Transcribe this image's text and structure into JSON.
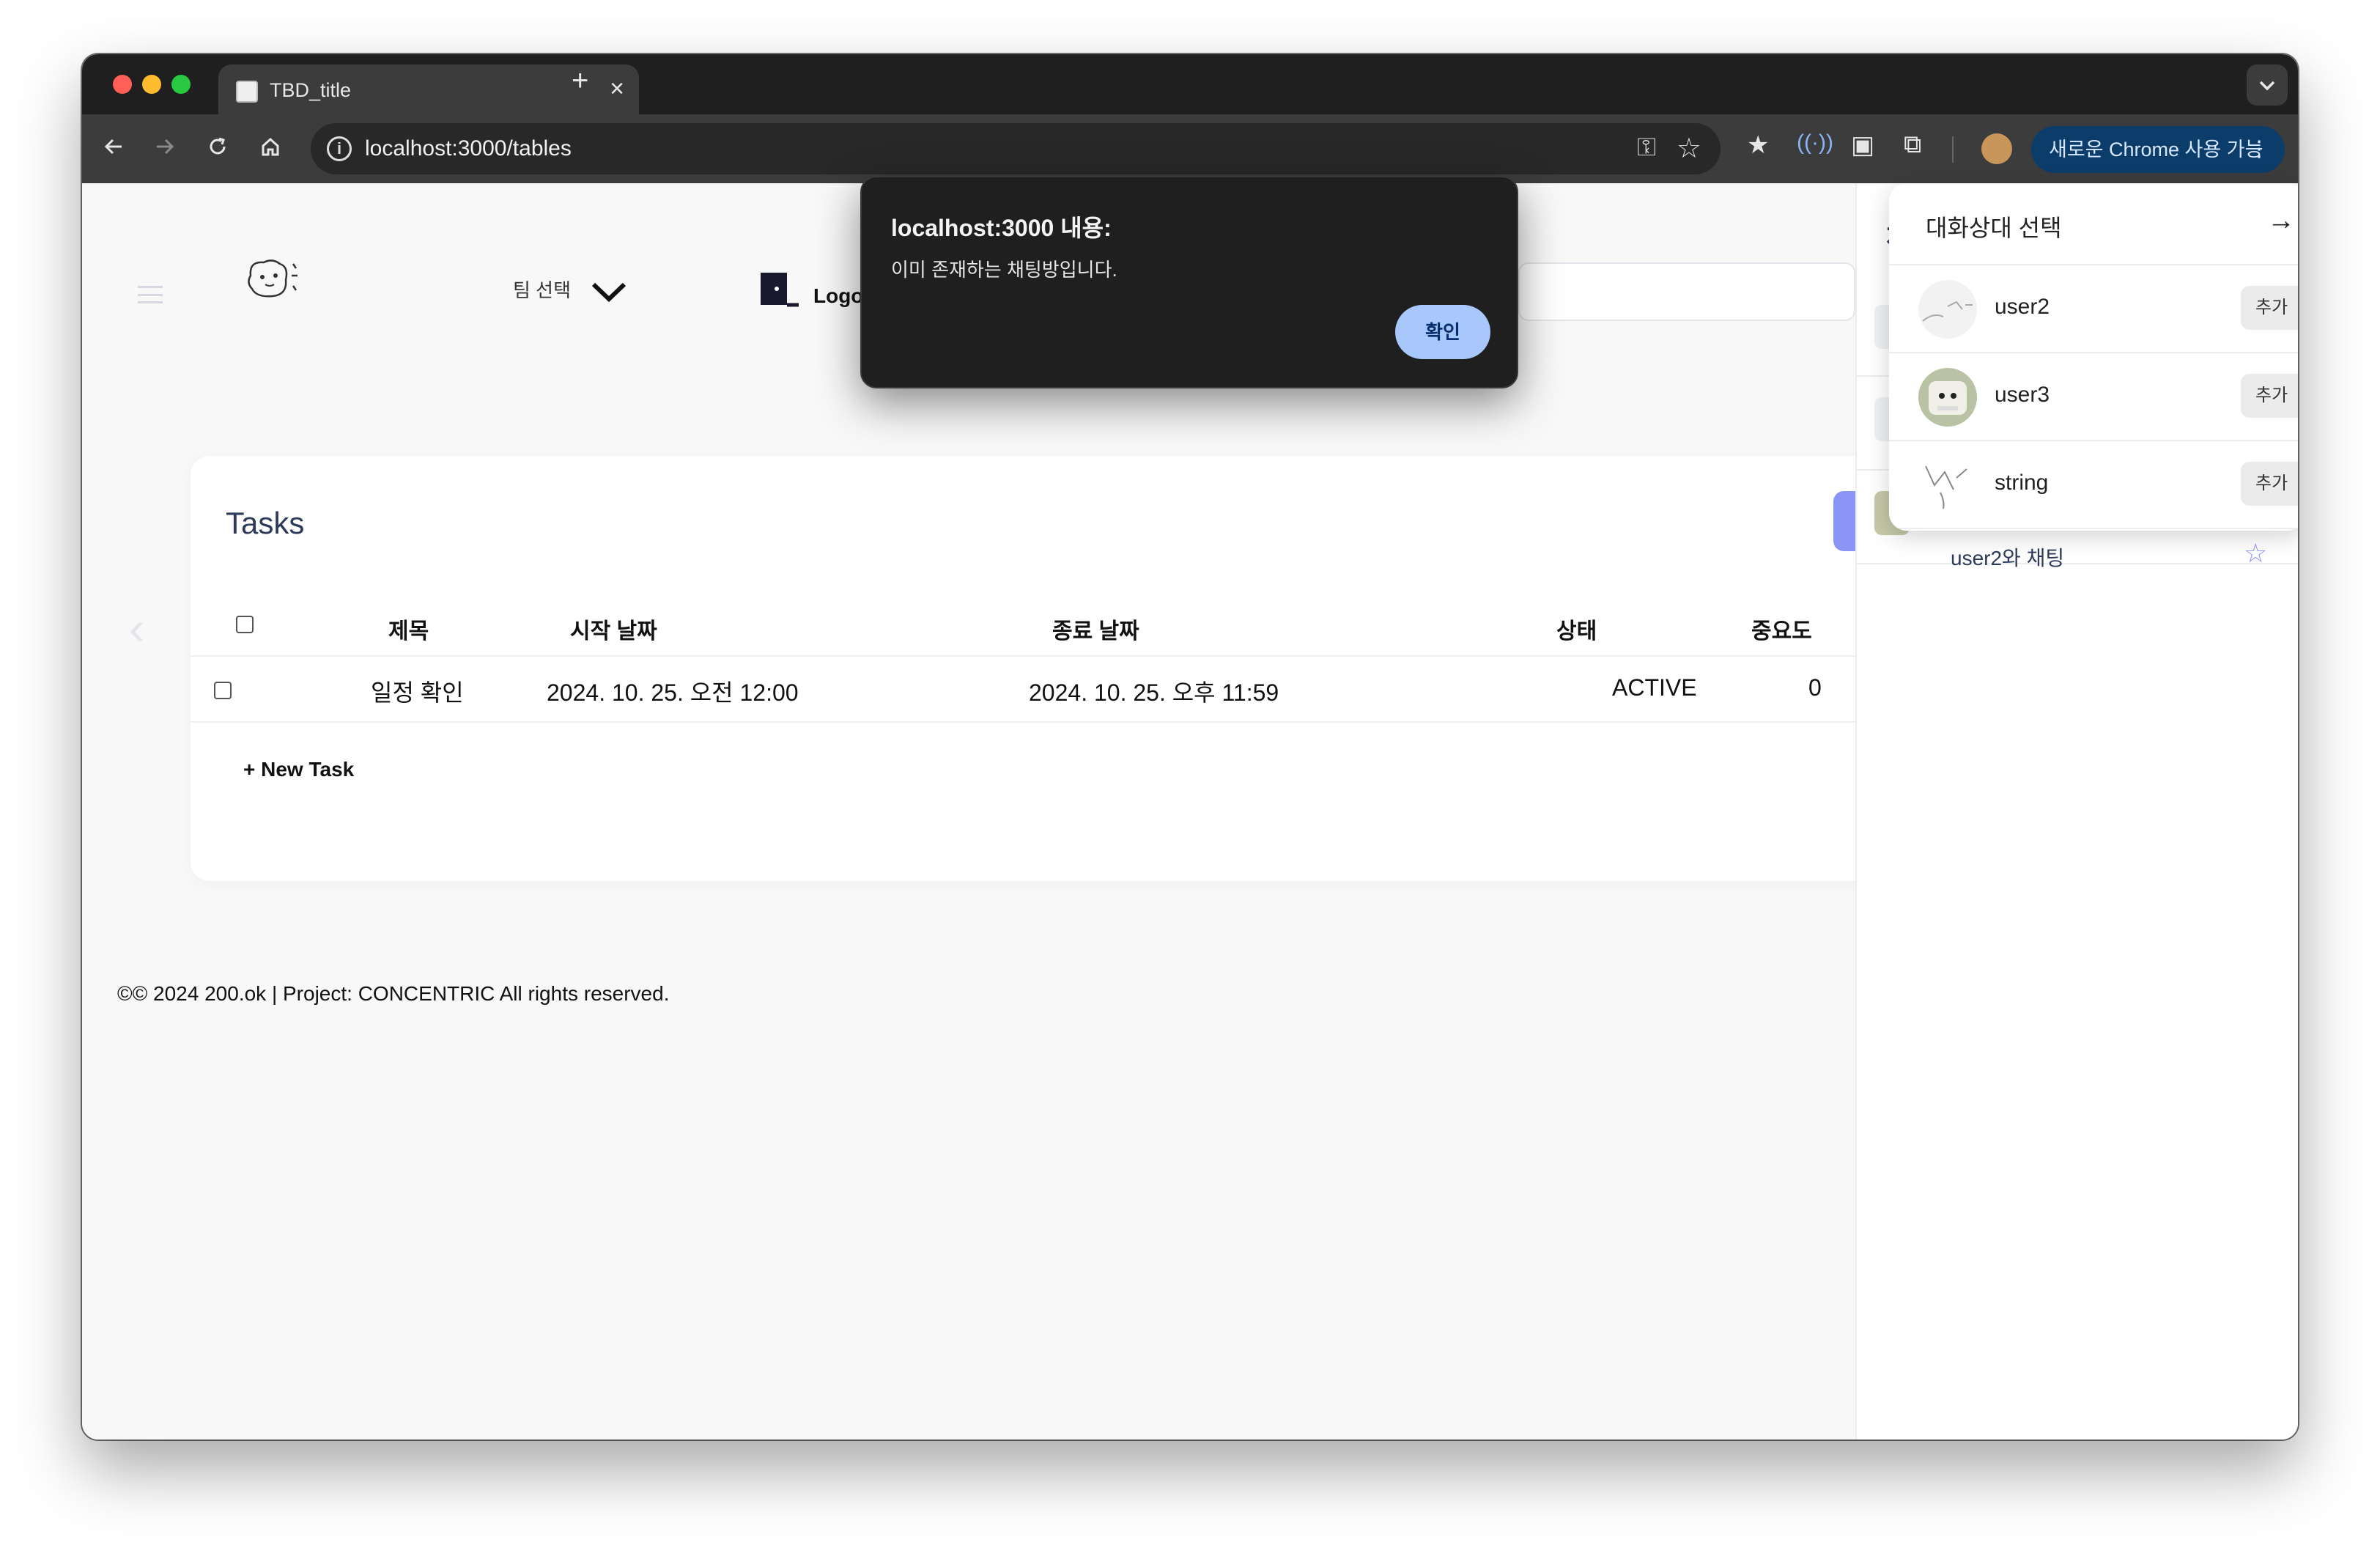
{
  "browser": {
    "tab_title": "TBD_title",
    "tab_close": "×",
    "new_tab": "+",
    "url": "localhost:3000/tables",
    "update_chip": "새로운 Chrome 사용 가능",
    "icons": [
      "back-icon",
      "forward-icon",
      "reload-icon",
      "home-icon",
      "info-icon",
      "key-icon",
      "bookmark-star-icon",
      "bookmarks-icon",
      "extension-icon",
      "screenshot-icon",
      "puzzle-icon",
      "profile-avatar",
      "more-icon"
    ]
  },
  "header": {
    "team_select": "팀 선택",
    "logout_label": "Logo"
  },
  "tasks": {
    "title": "Tasks",
    "columns": [
      "제목",
      "시작 날짜",
      "종료 날짜",
      "상태",
      "중요도"
    ],
    "rows": [
      {
        "title": "일정 확인",
        "start": "2024. 10. 25. 오전 12:00",
        "end": "2024. 10. 25. 오후 11:59",
        "status": "ACTIVE",
        "priority": "0"
      }
    ],
    "new_task": "+ New Task"
  },
  "footer": {
    "text": "©© 2024 200.ok | Project: CONCENTRIC All rights reserved."
  },
  "chat": {
    "title": "채팅",
    "add": "+",
    "visible_room": "user2와 채팅",
    "dropdown": {
      "title": "대화상대 선택",
      "arrow": "→",
      "users": [
        {
          "name": "user2",
          "add_label": "추가"
        },
        {
          "name": "user3",
          "add_label": "추가"
        },
        {
          "name": "string",
          "add_label": "추가"
        }
      ]
    }
  },
  "alert": {
    "title": "localhost:3000 내용:",
    "message": "이미 존재하는 채팅방입니다.",
    "ok": "확인"
  },
  "colors": {
    "accent": "#8a95f6",
    "alert_button": "#a8c7fa",
    "title_text": "#2e3a59"
  }
}
